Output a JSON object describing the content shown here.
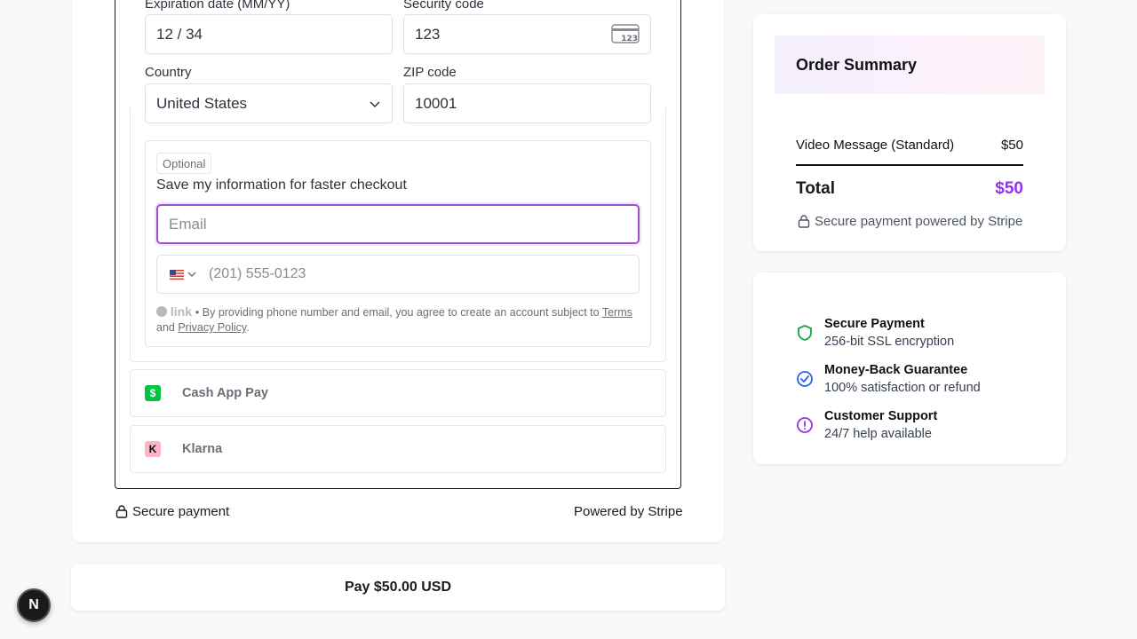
{
  "form": {
    "expiration_label": "Expiration date (MM/YY)",
    "expiration_value": "12 / 34",
    "security_label": "Security code",
    "security_value": "123",
    "cvc_icon_text": "123",
    "country_label": "Country",
    "country_value": "United States",
    "zip_label": "ZIP code",
    "zip_value": "10001"
  },
  "link": {
    "optional": "Optional",
    "save_text": "Save my information for faster checkout",
    "email_placeholder": "Email",
    "phone_placeholder": "(201) 555-0123",
    "brand": "link",
    "legal_prefix": "• By providing phone number and email, you agree to create an account subject to",
    "terms": "Terms",
    "and": "and",
    "privacy": "Privacy Policy",
    "period": "."
  },
  "methods": {
    "cashapp": "Cash App Pay",
    "klarna": "Klarna"
  },
  "footer": {
    "secure": "Secure payment",
    "powered": "Powered by Stripe"
  },
  "pay_button": "Pay $50.00 USD",
  "summary": {
    "title": "Order Summary",
    "item_name": "Video Message (Standard)",
    "item_price": "$50",
    "total_label": "Total",
    "total_value": "$50",
    "secure_note": "Secure payment powered by Stripe"
  },
  "trust": [
    {
      "title": "Secure Payment",
      "desc": "256-bit SSL encryption"
    },
    {
      "title": "Money-Back Guarantee",
      "desc": "100% satisfaction or refund"
    },
    {
      "title": "Customer Support",
      "desc": "24/7 help available"
    }
  ],
  "colors": {
    "accent_purple": "#9333ea",
    "shield_green": "#16a34a",
    "check_blue": "#2563eb",
    "alert_purple": "#9333ea"
  }
}
